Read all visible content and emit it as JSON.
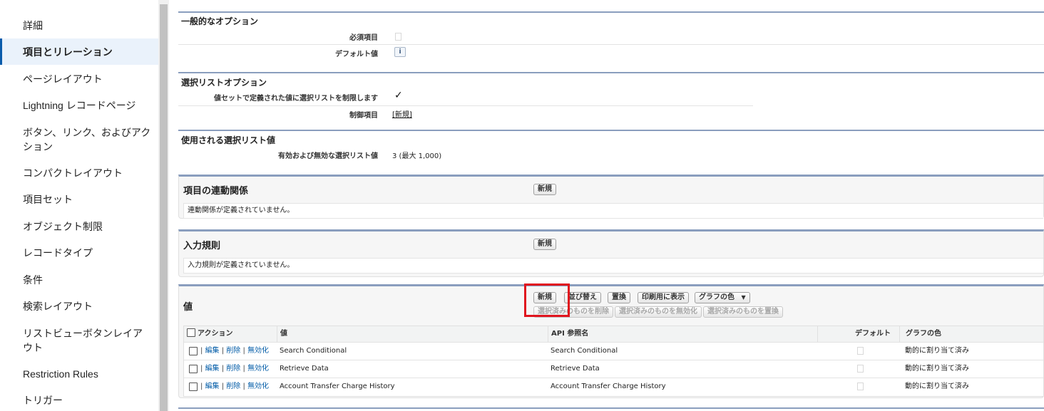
{
  "sidebar": {
    "items": [
      {
        "label": "詳細"
      },
      {
        "label": "項目とリレーション"
      },
      {
        "label": "ページレイアウト"
      },
      {
        "label": "Lightning レコードページ"
      },
      {
        "label": "ボタン、リンク、およびアクション"
      },
      {
        "label": "コンパクトレイアウト"
      },
      {
        "label": "項目セット"
      },
      {
        "label": "オブジェクト制限"
      },
      {
        "label": "レコードタイプ"
      },
      {
        "label": "条件"
      },
      {
        "label": "検索レイアウト"
      },
      {
        "label": "リストビューボタンレイアウト"
      },
      {
        "label": "Restriction Rules"
      },
      {
        "label": "トリガー"
      }
    ],
    "active_index": 1
  },
  "general": {
    "title": "一般的なオプション",
    "required_label": "必須項目",
    "required_checked": false,
    "default_label": "デフォルト値",
    "default_icon": "info-icon",
    "default_icon_text": "i"
  },
  "picklist_options": {
    "title": "選択リストオプション",
    "restrict_label": "値セットで定義された値に選択リストを制限します",
    "restrict_checked": true,
    "restrict_mark": "✓",
    "controlling_label": "制御項目",
    "controlling_value": "[新規]"
  },
  "used_values": {
    "title": "使用される選択リスト値",
    "count_label": "有効および無効な選択リスト値",
    "count_value": "3 (最大 1,000)"
  },
  "dependencies": {
    "title": "項目の連動関係",
    "new_button": "新規",
    "empty_message": "連動関係が定義されていません。"
  },
  "validation_rules": {
    "title": "入力規則",
    "new_button": "新規",
    "empty_message": "入力規則が定義されていません。"
  },
  "values": {
    "title": "値",
    "buttons": {
      "new": "新規",
      "reorder": "並び替え",
      "replace": "置換",
      "printable": "印刷用に表示",
      "chart_colors": "グラフの色",
      "chart_colors_arrow": "▼",
      "delete_selected": "選択済みのものを削除",
      "deactivate_selected": "選択済みのものを無効化",
      "replace_selected": "選択済みのものを置換"
    },
    "columns": {
      "action": "アクション",
      "value": "値",
      "api_name": "API 参照名",
      "default": "デフォルト",
      "chart_color": "グラフの色"
    },
    "action_links": {
      "edit": "編集",
      "delete": "削除",
      "deactivate": "無効化",
      "separator": "|"
    },
    "rows": [
      {
        "value": "Search Conditional",
        "api_name": "Search Conditional",
        "default": false,
        "chart_color": "動的に割り当て済み"
      },
      {
        "value": "Retrieve Data",
        "api_name": "Retrieve Data",
        "default": false,
        "chart_color": "動的に割り当て済み"
      },
      {
        "value": "Account Transfer Charge History",
        "api_name": "Account Transfer Charge History",
        "default": false,
        "chart_color": "動的に割り当て済み"
      }
    ]
  },
  "colors": {
    "accent_line": "#8a9ebe",
    "link": "#015ba7",
    "highlight": "#e0141e"
  }
}
